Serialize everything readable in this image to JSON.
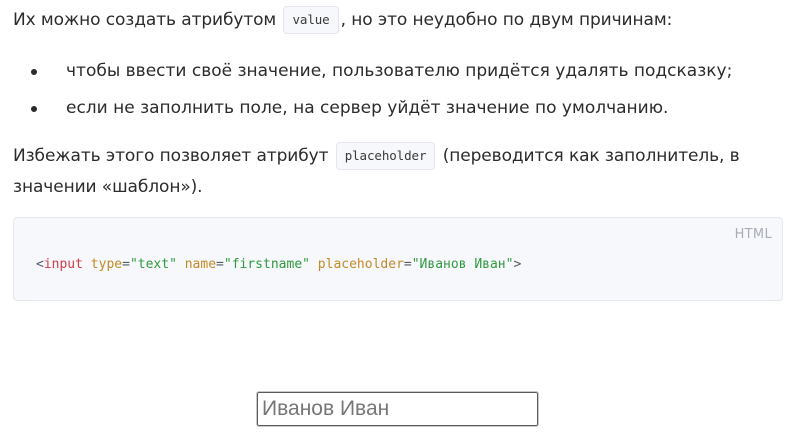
{
  "intro": {
    "before": "Их можно создать атрибутом",
    "code": "value",
    "after": ", но это неудобно по двум причинам:"
  },
  "reasons": [
    "чтобы ввести своё значение, пользователю придётся удалять подсказку;",
    "если не заполнить поле, на сервер уйдёт значение по умолчанию."
  ],
  "solution": {
    "before": "Избежать этого позволяет атрибут",
    "code": "placeholder",
    "after": "(переводится как заполнитель, в значении «шаблон»)."
  },
  "code_block": {
    "language": "HTML",
    "tokens": {
      "open": "<",
      "tag": "input",
      "attr1": "type",
      "val1": "\"text\"",
      "attr2": "name",
      "val2": "\"firstname\"",
      "attr3": "placeholder",
      "val3": "\"Иванов Иван\"",
      "close": ">"
    }
  },
  "demo": {
    "placeholder": "Иванов Иван"
  }
}
